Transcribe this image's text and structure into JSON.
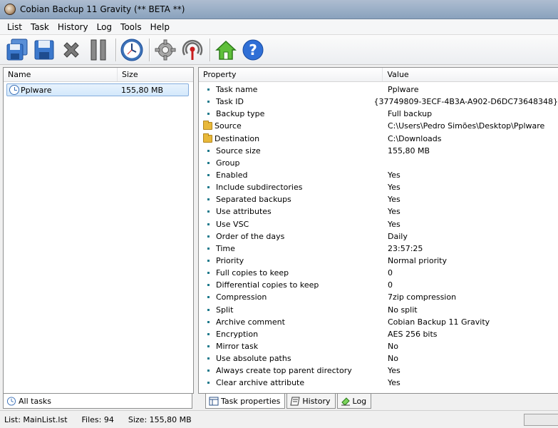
{
  "window": {
    "title": "Cobian Backup 11 Gravity (** BETA **)"
  },
  "menu": [
    "List",
    "Task",
    "History",
    "Log",
    "Tools",
    "Help"
  ],
  "toolbar_icons": [
    "backup-all-icon",
    "save-icon",
    "cancel-icon",
    "pause-icon",
    "scheduler-clock-icon",
    "settings-gear-icon",
    "antenna-icon",
    "home-icon",
    "help-icon"
  ],
  "task_list": {
    "columns": [
      "Name",
      "Size"
    ],
    "rows": [
      {
        "name": "Pplware",
        "size": "155,80 MB"
      }
    ]
  },
  "properties": {
    "columns": [
      "Property",
      "Value"
    ],
    "rows": [
      {
        "property": "Task name",
        "value": "Pplware"
      },
      {
        "property": "Task ID",
        "value": "{37749809-3ECF-4B3A-A902-D6DC73648348}"
      },
      {
        "property": "Backup type",
        "value": "Full backup"
      },
      {
        "property": "Source",
        "value": "C:\\Users\\Pedro Simões\\Desktop\\Pplware",
        "icon": "folder"
      },
      {
        "property": "Destination",
        "value": "C:\\Downloads",
        "icon": "folder"
      },
      {
        "property": "Source size",
        "value": "155,80 MB"
      },
      {
        "property": "Group",
        "value": ""
      },
      {
        "property": "Enabled",
        "value": "Yes"
      },
      {
        "property": "Include subdirectories",
        "value": "Yes"
      },
      {
        "property": "Separated backups",
        "value": "Yes"
      },
      {
        "property": "Use attributes",
        "value": "Yes"
      },
      {
        "property": "Use VSC",
        "value": "Yes"
      },
      {
        "property": "Order of the days",
        "value": "Daily"
      },
      {
        "property": "Time",
        "value": "23:57:25"
      },
      {
        "property": "Priority",
        "value": "Normal priority"
      },
      {
        "property": "Full copies to keep",
        "value": "0"
      },
      {
        "property": "Differential copies to keep",
        "value": "0"
      },
      {
        "property": "Compression",
        "value": "7zip compression"
      },
      {
        "property": "Split",
        "value": "No split"
      },
      {
        "property": "Archive comment",
        "value": "Cobian Backup 11 Gravity"
      },
      {
        "property": "Encryption",
        "value": "AES 256 bits"
      },
      {
        "property": "Mirror task",
        "value": "No"
      },
      {
        "property": "Use absolute paths",
        "value": "No"
      },
      {
        "property": "Always create top parent directory",
        "value": "Yes"
      },
      {
        "property": "Clear archive attribute",
        "value": "Yes"
      }
    ]
  },
  "tabs_left": [
    {
      "label": "All tasks",
      "icon": "clock-icon"
    }
  ],
  "tabs_right": [
    {
      "label": "Task properties",
      "icon": "properties-icon"
    },
    {
      "label": "History",
      "icon": "history-icon"
    },
    {
      "label": "Log",
      "icon": "log-icon"
    }
  ],
  "status": {
    "list": "List: MainList.lst",
    "files": "Files: 94",
    "size": "Size: 155,80 MB"
  }
}
